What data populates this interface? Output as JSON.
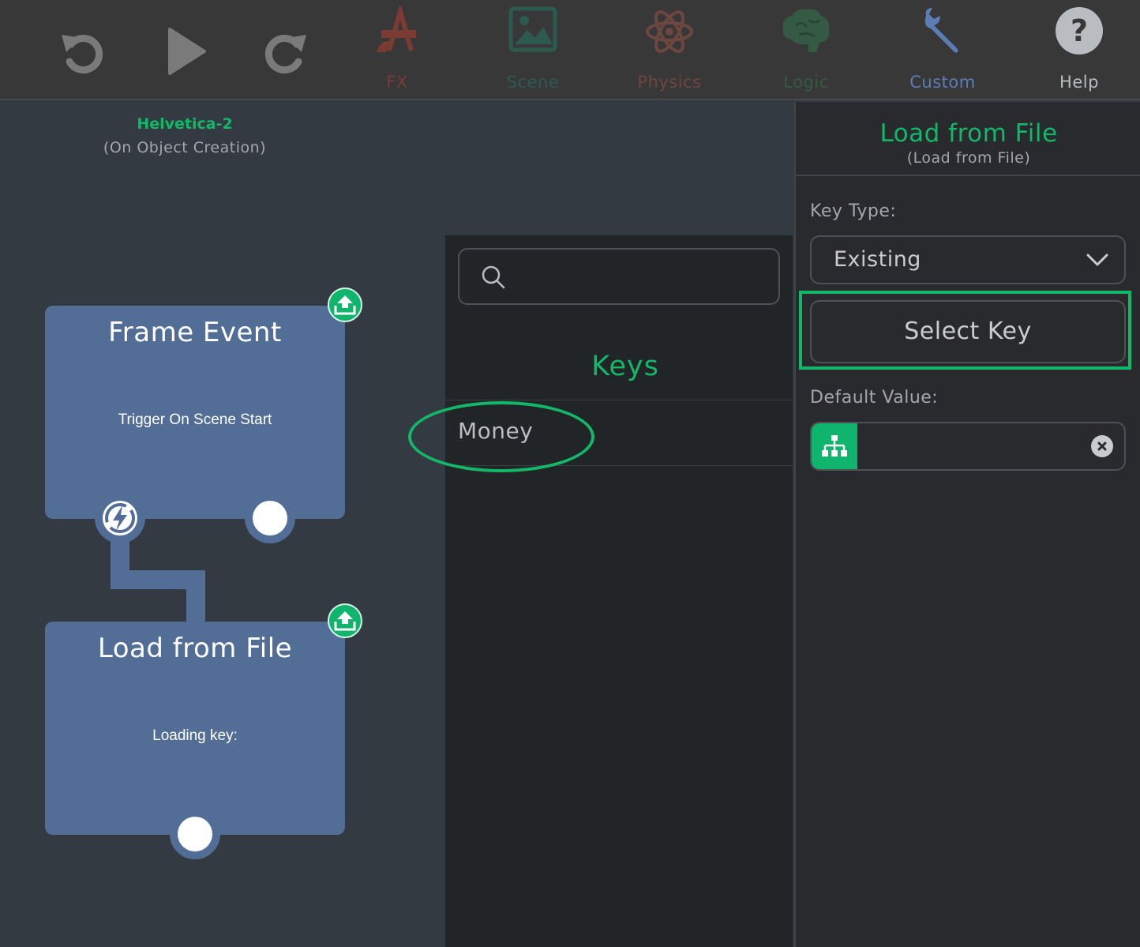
{
  "toolbar": {
    "tabs": [
      {
        "label": "FX",
        "icon": "fx-brush-ruler-icon",
        "color": "#7a3b33"
      },
      {
        "label": "Scene",
        "icon": "image-icon",
        "color": "#2c5a4f"
      },
      {
        "label": "Physics",
        "icon": "atom-icon",
        "color": "#6e4640"
      },
      {
        "label": "Logic",
        "icon": "brain-icon",
        "color": "#355a44"
      },
      {
        "label": "Custom",
        "icon": "wrench-icon",
        "color": "#5a7db4"
      },
      {
        "label": "Help",
        "icon": "help-icon",
        "color": "#b9bcc0"
      }
    ]
  },
  "workspace": {
    "object_name": "Helvetica-2",
    "object_subtitle": "(On Object Creation)",
    "nodes": [
      {
        "title": "Frame Event",
        "body": "Trigger On Scene Start"
      },
      {
        "title": "Load from File",
        "body": "Loading key:"
      }
    ]
  },
  "keys_panel": {
    "search_placeholder": "",
    "title": "Keys",
    "items": [
      "Money"
    ]
  },
  "properties": {
    "title": "Load from File",
    "subtitle": "(Load from File)",
    "key_type_label": "Key Type:",
    "key_type_value": "Existing",
    "select_key_label": "Select Key",
    "default_value_label": "Default Value:",
    "default_value": ""
  },
  "colors": {
    "accent": "#12b868",
    "node": "#526e96"
  }
}
